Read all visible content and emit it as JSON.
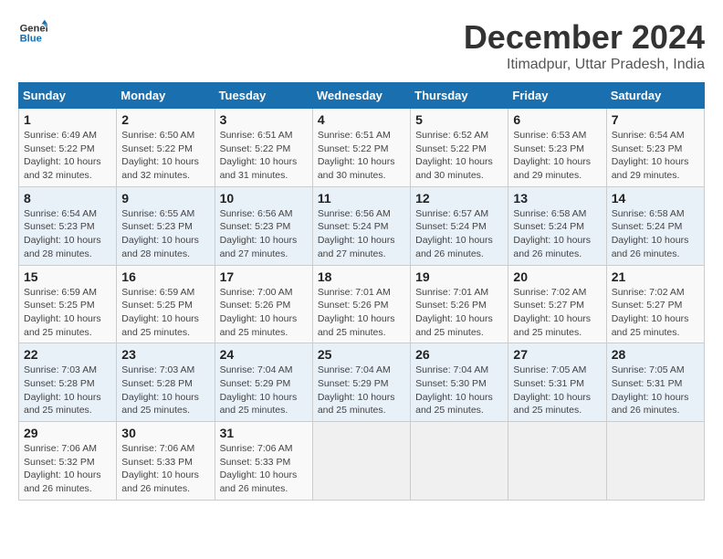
{
  "logo": {
    "line1": "General",
    "line2": "Blue"
  },
  "title": "December 2024",
  "subtitle": "Itimadpur, Uttar Pradesh, India",
  "days_of_week": [
    "Sunday",
    "Monday",
    "Tuesday",
    "Wednesday",
    "Thursday",
    "Friday",
    "Saturday"
  ],
  "weeks": [
    [
      {
        "day": "1",
        "info": "Sunrise: 6:49 AM\nSunset: 5:22 PM\nDaylight: 10 hours\nand 32 minutes."
      },
      {
        "day": "2",
        "info": "Sunrise: 6:50 AM\nSunset: 5:22 PM\nDaylight: 10 hours\nand 32 minutes."
      },
      {
        "day": "3",
        "info": "Sunrise: 6:51 AM\nSunset: 5:22 PM\nDaylight: 10 hours\nand 31 minutes."
      },
      {
        "day": "4",
        "info": "Sunrise: 6:51 AM\nSunset: 5:22 PM\nDaylight: 10 hours\nand 30 minutes."
      },
      {
        "day": "5",
        "info": "Sunrise: 6:52 AM\nSunset: 5:22 PM\nDaylight: 10 hours\nand 30 minutes."
      },
      {
        "day": "6",
        "info": "Sunrise: 6:53 AM\nSunset: 5:23 PM\nDaylight: 10 hours\nand 29 minutes."
      },
      {
        "day": "7",
        "info": "Sunrise: 6:54 AM\nSunset: 5:23 PM\nDaylight: 10 hours\nand 29 minutes."
      }
    ],
    [
      {
        "day": "8",
        "info": "Sunrise: 6:54 AM\nSunset: 5:23 PM\nDaylight: 10 hours\nand 28 minutes."
      },
      {
        "day": "9",
        "info": "Sunrise: 6:55 AM\nSunset: 5:23 PM\nDaylight: 10 hours\nand 28 minutes."
      },
      {
        "day": "10",
        "info": "Sunrise: 6:56 AM\nSunset: 5:23 PM\nDaylight: 10 hours\nand 27 minutes."
      },
      {
        "day": "11",
        "info": "Sunrise: 6:56 AM\nSunset: 5:24 PM\nDaylight: 10 hours\nand 27 minutes."
      },
      {
        "day": "12",
        "info": "Sunrise: 6:57 AM\nSunset: 5:24 PM\nDaylight: 10 hours\nand 26 minutes."
      },
      {
        "day": "13",
        "info": "Sunrise: 6:58 AM\nSunset: 5:24 PM\nDaylight: 10 hours\nand 26 minutes."
      },
      {
        "day": "14",
        "info": "Sunrise: 6:58 AM\nSunset: 5:24 PM\nDaylight: 10 hours\nand 26 minutes."
      }
    ],
    [
      {
        "day": "15",
        "info": "Sunrise: 6:59 AM\nSunset: 5:25 PM\nDaylight: 10 hours\nand 25 minutes."
      },
      {
        "day": "16",
        "info": "Sunrise: 6:59 AM\nSunset: 5:25 PM\nDaylight: 10 hours\nand 25 minutes."
      },
      {
        "day": "17",
        "info": "Sunrise: 7:00 AM\nSunset: 5:26 PM\nDaylight: 10 hours\nand 25 minutes."
      },
      {
        "day": "18",
        "info": "Sunrise: 7:01 AM\nSunset: 5:26 PM\nDaylight: 10 hours\nand 25 minutes."
      },
      {
        "day": "19",
        "info": "Sunrise: 7:01 AM\nSunset: 5:26 PM\nDaylight: 10 hours\nand 25 minutes."
      },
      {
        "day": "20",
        "info": "Sunrise: 7:02 AM\nSunset: 5:27 PM\nDaylight: 10 hours\nand 25 minutes."
      },
      {
        "day": "21",
        "info": "Sunrise: 7:02 AM\nSunset: 5:27 PM\nDaylight: 10 hours\nand 25 minutes."
      }
    ],
    [
      {
        "day": "22",
        "info": "Sunrise: 7:03 AM\nSunset: 5:28 PM\nDaylight: 10 hours\nand 25 minutes."
      },
      {
        "day": "23",
        "info": "Sunrise: 7:03 AM\nSunset: 5:28 PM\nDaylight: 10 hours\nand 25 minutes."
      },
      {
        "day": "24",
        "info": "Sunrise: 7:04 AM\nSunset: 5:29 PM\nDaylight: 10 hours\nand 25 minutes."
      },
      {
        "day": "25",
        "info": "Sunrise: 7:04 AM\nSunset: 5:29 PM\nDaylight: 10 hours\nand 25 minutes."
      },
      {
        "day": "26",
        "info": "Sunrise: 7:04 AM\nSunset: 5:30 PM\nDaylight: 10 hours\nand 25 minutes."
      },
      {
        "day": "27",
        "info": "Sunrise: 7:05 AM\nSunset: 5:31 PM\nDaylight: 10 hours\nand 25 minutes."
      },
      {
        "day": "28",
        "info": "Sunrise: 7:05 AM\nSunset: 5:31 PM\nDaylight: 10 hours\nand 26 minutes."
      }
    ],
    [
      {
        "day": "29",
        "info": "Sunrise: 7:06 AM\nSunset: 5:32 PM\nDaylight: 10 hours\nand 26 minutes."
      },
      {
        "day": "30",
        "info": "Sunrise: 7:06 AM\nSunset: 5:33 PM\nDaylight: 10 hours\nand 26 minutes."
      },
      {
        "day": "31",
        "info": "Sunrise: 7:06 AM\nSunset: 5:33 PM\nDaylight: 10 hours\nand 26 minutes."
      },
      {
        "day": "",
        "info": ""
      },
      {
        "day": "",
        "info": ""
      },
      {
        "day": "",
        "info": ""
      },
      {
        "day": "",
        "info": ""
      }
    ]
  ]
}
